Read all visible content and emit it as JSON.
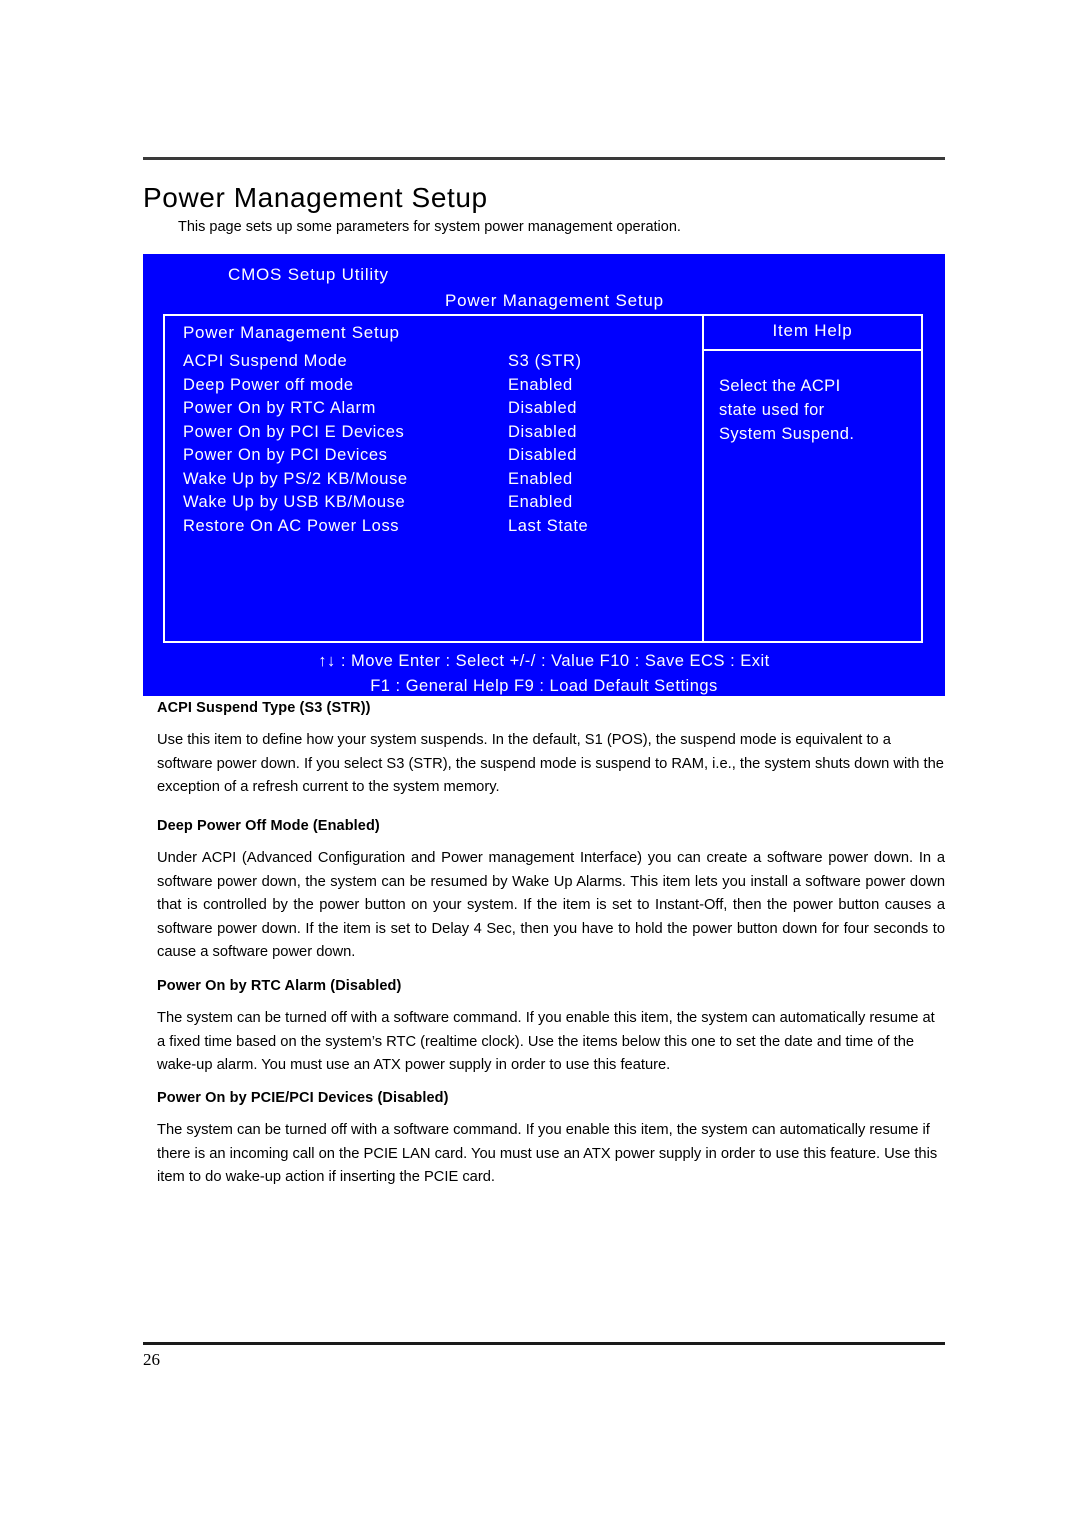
{
  "document": {
    "page_title": "Power Management Setup",
    "intro": "This page sets up some parameters for system power management operation.",
    "page_number": "26"
  },
  "bios": {
    "utility_title": "CMOS Setup Utility",
    "screen_title": "Power Management Setup",
    "section_header": "Power Management Setup",
    "help_title": "Item Help",
    "help_lines": [
      "Select the ACPI",
      "state used for",
      "System Suspend."
    ],
    "background_color": "#0000ff",
    "text_color": "#ffffff",
    "rows": [
      {
        "label": "ACPI Suspend Mode",
        "value": "S3 (STR)"
      },
      {
        "label": "Deep Power off mode",
        "value": "Enabled"
      },
      {
        "label": "Power On by RTC Alarm",
        "value": "Disabled"
      },
      {
        "label": "Power On by PCI E Devices",
        "value": "Disabled"
      },
      {
        "label": "Power On by PCI Devices",
        "value": "Disabled"
      },
      {
        "label": "Wake Up by PS/2 KB/Mouse",
        "value": "Enabled"
      },
      {
        "label": "Wake Up by USB KB/Mouse",
        "value": "Enabled"
      },
      {
        "label": "Restore On AC Power Loss",
        "value": "Last State"
      }
    ],
    "key_hints": [
      "↑↓ : Move   Enter : Select   +/-/ : Value   F10 : Save ECS : Exit",
      "F1 : General Help      F9 : Load Default Settings"
    ]
  },
  "sections": [
    {
      "heading": "ACPI Suspend Type (S3 (STR))",
      "body": "Use this item to define how your system suspends. In the default, S1 (POS), the suspend mode is equivalent to a software power down. If you select S3 (STR), the suspend mode is suspend to RAM, i.e., the system shuts down with the exception of a refresh current to the system memory."
    },
    {
      "heading": "Deep Power Off Mode (Enabled)",
      "body": "Under ACPI (Advanced Configuration and Power management Interface) you can create a software power down. In a software power down, the system can be resumed by Wake Up Alarms. This item lets you install a software power down that is controlled by the power button on your system. If the item is set to Instant-Off, then the power button causes a software power down. If the item is set to Delay 4 Sec, then you have to hold the power button down for four seconds to cause a software power down."
    },
    {
      "heading": "Power On by RTC Alarm (Disabled)",
      "body": "The system can be turned off with a software command. If you enable this item, the system can automatically resume at a fixed time based on the system’s RTC (realtime clock). Use the items below this one to set the date and time of the wake-up alarm. You must use an ATX power supply in order to use this feature."
    },
    {
      "heading": "Power On by PCIE/PCI Devices (Disabled)",
      "body": "The system can be turned off with a software command. If you enable this item, the system can automatically resume if there is an incoming call on the PCIE LAN card. You must use an ATX power supply in order to use this feature. Use this item to do wake-up action if inserting the PCIE card."
    }
  ]
}
